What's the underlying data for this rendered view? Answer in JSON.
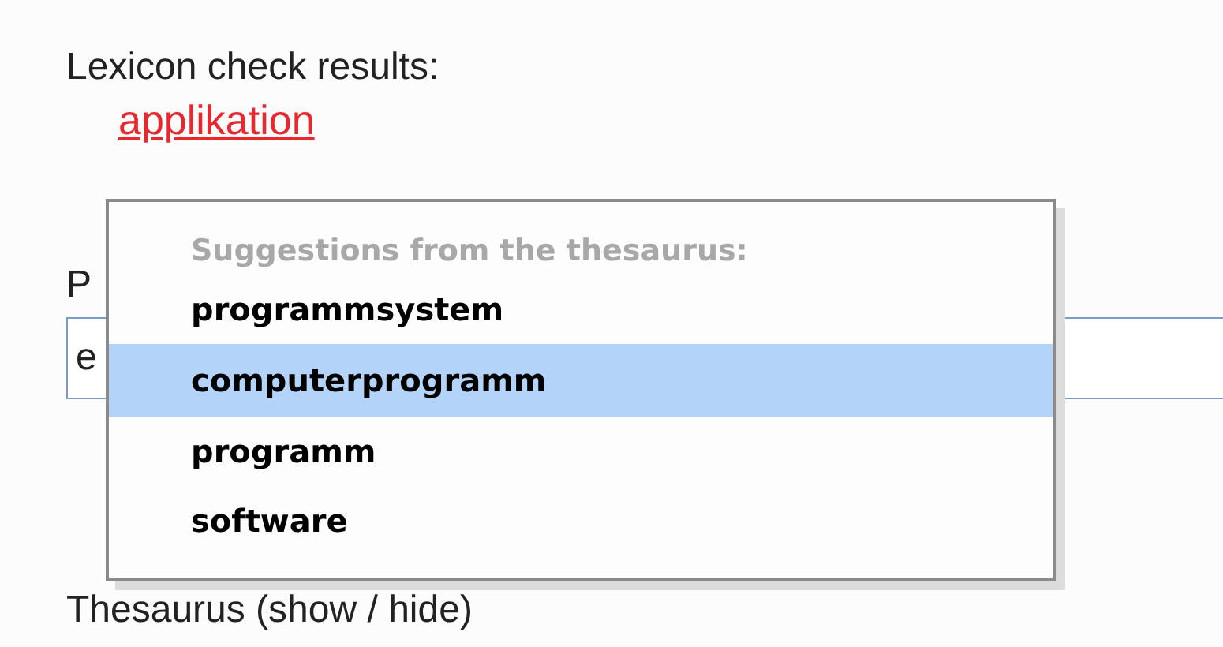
{
  "lexicon": {
    "heading": "Lexicon check results:",
    "link": "applikation"
  },
  "field": {
    "label": "P",
    "value": "e"
  },
  "thesaurus_toggle": "Thesaurus (show / hide)",
  "popup": {
    "heading": "Suggestions from the thesaurus:",
    "items": [
      {
        "label": "programmsystem",
        "selected": false
      },
      {
        "label": "computerprogramm",
        "selected": true
      },
      {
        "label": "programm",
        "selected": false
      },
      {
        "label": "software",
        "selected": false
      }
    ]
  }
}
